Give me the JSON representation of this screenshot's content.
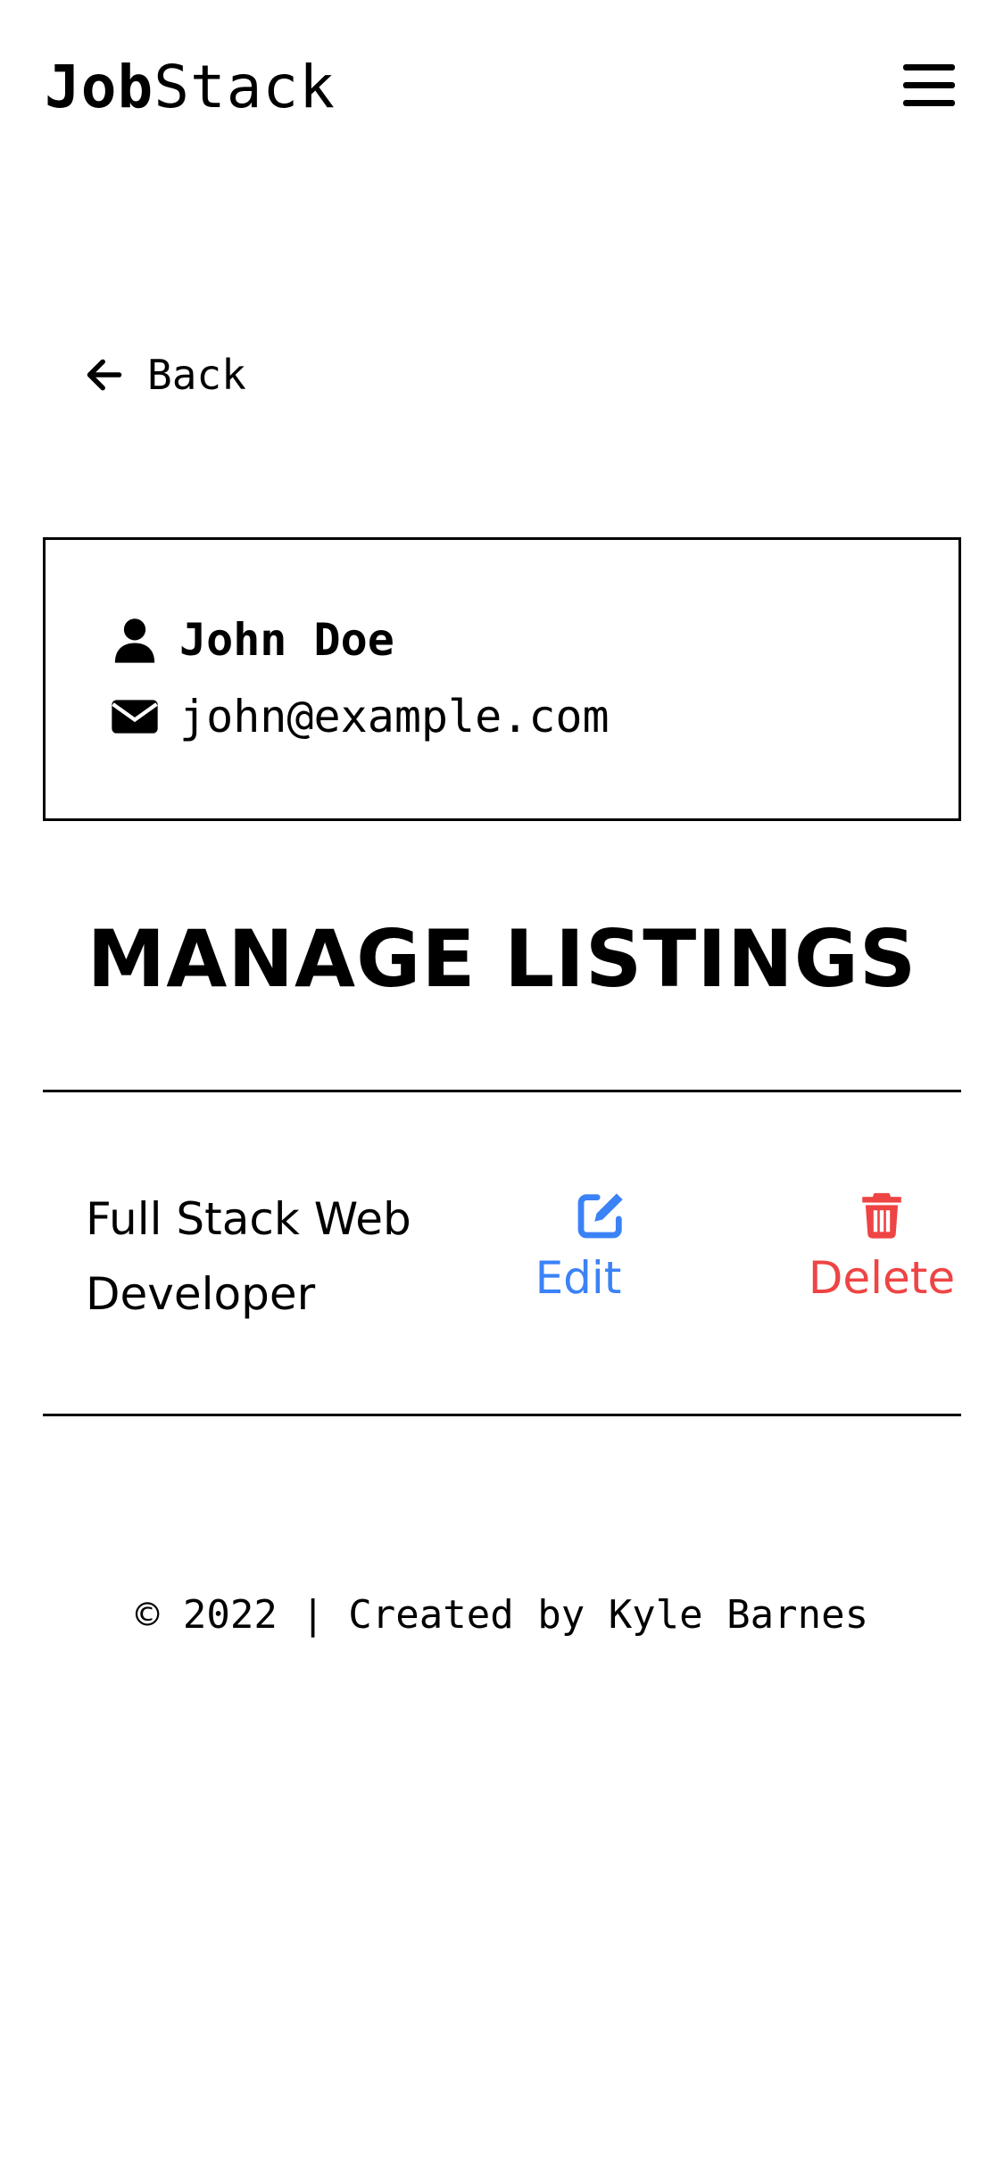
{
  "header": {
    "logo_bold": "Job",
    "logo_regular": "Stack",
    "menu_icon": "hamburger-menu-icon"
  },
  "back": {
    "label": "Back",
    "icon": "arrow-left-icon"
  },
  "profile": {
    "name": "John Doe",
    "email": "john@example.com",
    "name_icon": "user-icon",
    "email_icon": "envelope-icon"
  },
  "manage": {
    "title": "MANAGE LISTINGS",
    "listings": [
      {
        "title": "Full Stack Web Developer",
        "edit_label": "Edit",
        "delete_label": "Delete",
        "edit_icon": "edit-icon",
        "delete_icon": "trash-icon"
      }
    ]
  },
  "colors": {
    "edit": "#3b82f6",
    "delete": "#ef4444",
    "text": "#000000",
    "background": "#ffffff"
  },
  "footer": {
    "text": "© 2022 | Created by Kyle Barnes"
  }
}
